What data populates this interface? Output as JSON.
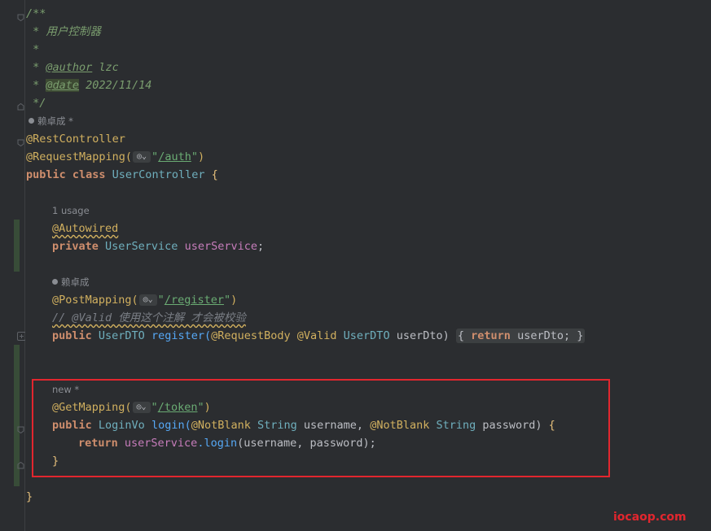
{
  "doc": {
    "open": "/**",
    "title": " * 用户控制器",
    "blank": " *",
    "author_prefix": " * ",
    "author_tag": "@author",
    "author_val": " lzc",
    "date_prefix": " * ",
    "date_tag": "@date",
    "date_val": " 2022/11/14",
    "close": " */"
  },
  "hints": {
    "class_author": "赖卓成 *",
    "usage": "1 usage",
    "register_author": "赖卓成",
    "new_label": "new *"
  },
  "code": {
    "rest_controller": "@RestController",
    "request_mapping": "@RequestMapping(",
    "auth_quote_open": "\"",
    "auth_path": "/auth",
    "auth_quote_close": "\"",
    "close_paren": ")",
    "class_kw": "public class ",
    "class_name": "UserController",
    "class_brace": " {",
    "autowired": "@Autowired",
    "private_kw": "private ",
    "service_type": "UserService",
    "service_field": " userService",
    "semicolon": ";",
    "post_mapping": "@PostMapping(",
    "register_path": "/register",
    "valid_comment": "// @Valid 使用这个注解 才会被校验",
    "public_kw": "public ",
    "dto_type": "UserDTO",
    "register_name": " register(",
    "request_body": "@RequestBody",
    "valid_ann": " @Valid ",
    "dto_param_type": "UserDTO",
    "dto_param": " userDto",
    "register_body_open": "{",
    "return_kw": "return ",
    "user_dto_ret": "userDto;",
    "register_body_close": "}",
    "get_mapping": "@GetMapping(",
    "token_path": "/token",
    "login_type": "LoginVo",
    "login_name": " login(",
    "not_blank_1": "@NotBlank",
    "string_type_1": " String",
    "username_param": " username, ",
    "not_blank_2": "@NotBlank",
    "string_type_2": " String",
    "password_param": " password) ",
    "login_open": "{",
    "login_return_kw": "return ",
    "login_call_field": "userService",
    "login_call_method": ".login",
    "login_call_args": "(username, password);",
    "login_close": "}",
    "class_close": "}"
  },
  "watermark": "iocaop.com",
  "colors": {
    "background": "#2b2d30",
    "annotation": "#d1b05f",
    "keyword": "#cf8e6d",
    "class": "#6fafbd",
    "string": "#6aab73",
    "highlight_box": "#e2262e"
  },
  "icons": [
    "fold-icon",
    "user-icon",
    "globe-icon",
    "chevron-down-icon"
  ]
}
